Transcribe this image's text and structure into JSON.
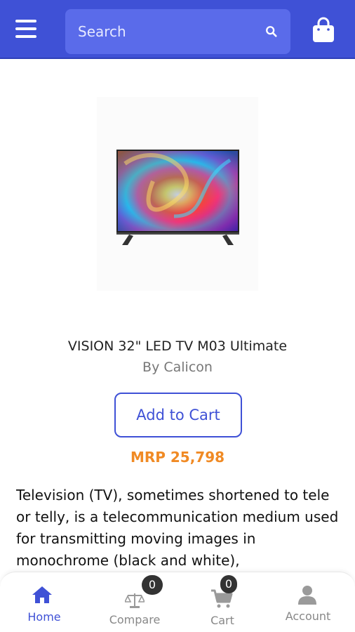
{
  "header": {
    "search_placeholder": "Search"
  },
  "product": {
    "title": "VISION 32\" LED TV M03 Ultimate",
    "brand": "By Calicon",
    "add_to_cart_label": "Add to Cart",
    "price": "MRP 25,798",
    "description": "Television (TV), sometimes shortened to tele or telly, is a telecommunication medium used for transmitting moving images in monochrome (black and white),"
  },
  "bottom_nav": {
    "items": [
      {
        "label": "Home",
        "icon": "home-icon",
        "active": true
      },
      {
        "label": "Compare",
        "icon": "compare-icon",
        "badge": "0"
      },
      {
        "label": "Cart",
        "icon": "cart-icon",
        "badge": "0"
      },
      {
        "label": "Account",
        "icon": "account-icon"
      }
    ]
  },
  "colors": {
    "primary": "#3f51d6",
    "price": "#f08a24"
  }
}
